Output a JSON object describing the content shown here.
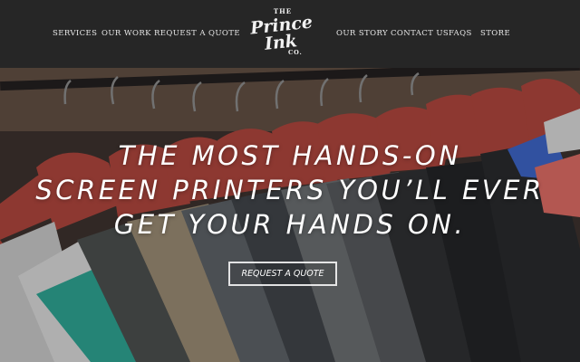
{
  "nav": {
    "left": [
      "SERVICES",
      "OUR WORK",
      "REQUEST A QUOTE"
    ],
    "right": [
      "OUR STORY",
      "CONTACT US",
      "FAQS",
      "STORE"
    ]
  },
  "logo": {
    "the": "THE",
    "prince": "Prince",
    "ink": "Ink",
    "co": "CO."
  },
  "hero": {
    "headline": [
      "THE MOST HANDS-ON",
      "SCREEN PRINTERS YOU’LL EVER",
      "GET YOUR HANDS ON."
    ],
    "cta_label": "REQUEST A QUOTE"
  },
  "colors": {
    "nav_background": "#262626",
    "nav_text": "#e9e9e9",
    "hanger_wood": "#b0433a",
    "cta_border": "#ffffff"
  }
}
